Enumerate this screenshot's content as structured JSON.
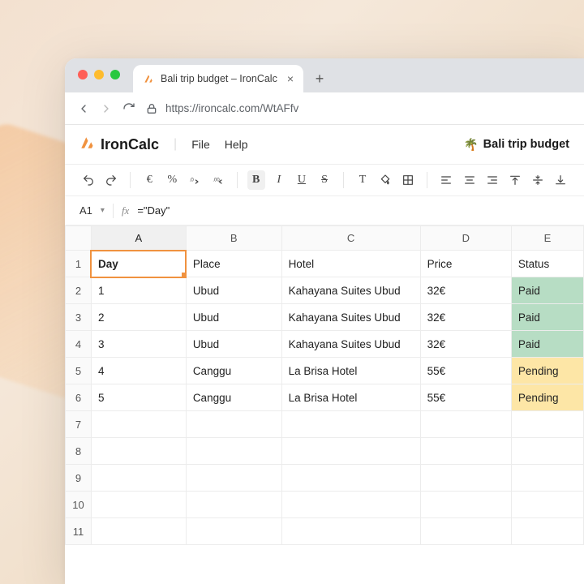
{
  "browser": {
    "tab_title": "Bali trip budget – IronCalc",
    "url": "https://ironcalc.com/WtAFfv"
  },
  "app": {
    "name": "IronCalc",
    "menus": {
      "file": "File",
      "help": "Help"
    },
    "doc_emoji": "🌴",
    "doc_title": "Bali trip budget"
  },
  "formula_bar": {
    "cell_ref": "A1",
    "fx_label": "fx",
    "formula": "=\"Day\""
  },
  "columns": [
    "A",
    "B",
    "C",
    "D",
    "E"
  ],
  "row_numbers": [
    "1",
    "2",
    "3",
    "4",
    "5",
    "6",
    "7",
    "8",
    "9",
    "10",
    "11"
  ],
  "active_cell": {
    "row": 0,
    "col": 0
  },
  "cells": [
    {
      "A": "Day",
      "B": "Place",
      "C": "Hotel",
      "D": "Price",
      "E": "Status"
    },
    {
      "A": "1",
      "B": "Ubud",
      "C": "Kahayana Suites Ubud",
      "D": "32€",
      "E": "Paid",
      "E_status": "paid"
    },
    {
      "A": "2",
      "B": "Ubud",
      "C": "Kahayana Suites Ubud",
      "D": "32€",
      "E": "Paid",
      "E_status": "paid"
    },
    {
      "A": "3",
      "B": "Ubud",
      "C": "Kahayana Suites Ubud",
      "D": "32€",
      "E": "Paid",
      "E_status": "paid"
    },
    {
      "A": "4",
      "B": "Canggu",
      "C": "La Brisa Hotel",
      "D": "55€",
      "E": "Pending",
      "E_status": "pending"
    },
    {
      "A": "5",
      "B": "Canggu",
      "C": "La Brisa Hotel",
      "D": "55€",
      "E": "Pending",
      "E_status": "pending"
    },
    {
      "A": "",
      "B": "",
      "C": "",
      "D": "",
      "E": ""
    },
    {
      "A": "",
      "B": "",
      "C": "",
      "D": "",
      "E": ""
    },
    {
      "A": "",
      "B": "",
      "C": "",
      "D": "",
      "E": ""
    },
    {
      "A": "",
      "B": "",
      "C": "",
      "D": "",
      "E": ""
    },
    {
      "A": "",
      "B": "",
      "C": "",
      "D": "",
      "E": ""
    }
  ]
}
